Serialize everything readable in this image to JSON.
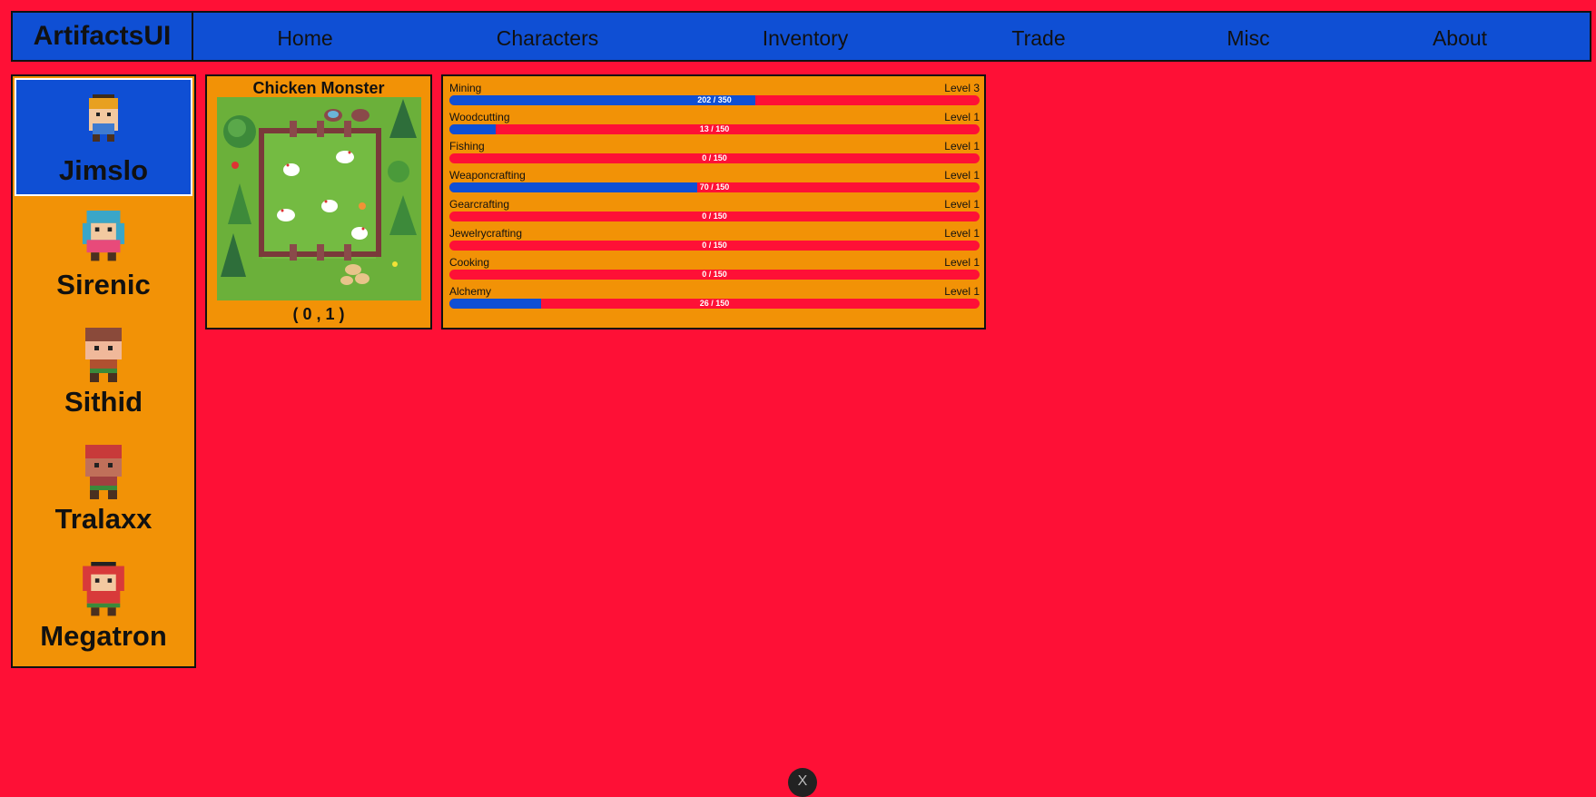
{
  "header": {
    "brand": "ArtifactsUI",
    "nav": [
      "Home",
      "Characters",
      "Inventory",
      "Trade",
      "Misc",
      "About"
    ]
  },
  "sidebar": {
    "characters": [
      {
        "name": "Jimslo",
        "selected": true
      },
      {
        "name": "Sirenic",
        "selected": false
      },
      {
        "name": "Sithid",
        "selected": false
      },
      {
        "name": "Tralaxx",
        "selected": false
      },
      {
        "name": "Megatron",
        "selected": false
      }
    ]
  },
  "map": {
    "title": "Chicken Monster",
    "coords": "( 0 , 1 )"
  },
  "skills": [
    {
      "name": "Mining",
      "level": "Level 3",
      "progress": "202 / 350",
      "fraction": 0.577
    },
    {
      "name": "Woodcutting",
      "level": "Level 1",
      "progress": "13 / 150",
      "fraction": 0.087
    },
    {
      "name": "Fishing",
      "level": "Level 1",
      "progress": "0 / 150",
      "fraction": 0
    },
    {
      "name": "Weaponcrafting",
      "level": "Level 1",
      "progress": "70 / 150",
      "fraction": 0.467
    },
    {
      "name": "Gearcrafting",
      "level": "Level 1",
      "progress": "0 / 150",
      "fraction": 0
    },
    {
      "name": "Jewelrycrafting",
      "level": "Level 1",
      "progress": "0 / 150",
      "fraction": 0
    },
    {
      "name": "Cooking",
      "level": "Level 1",
      "progress": "0 / 150",
      "fraction": 0
    },
    {
      "name": "Alchemy",
      "level": "Level 1",
      "progress": "26 / 150",
      "fraction": 0.173
    }
  ],
  "footer": {
    "close_label": "X"
  },
  "colors": {
    "background": "#fe1036",
    "primary": "#0f4fd4",
    "card": "#f29206"
  }
}
